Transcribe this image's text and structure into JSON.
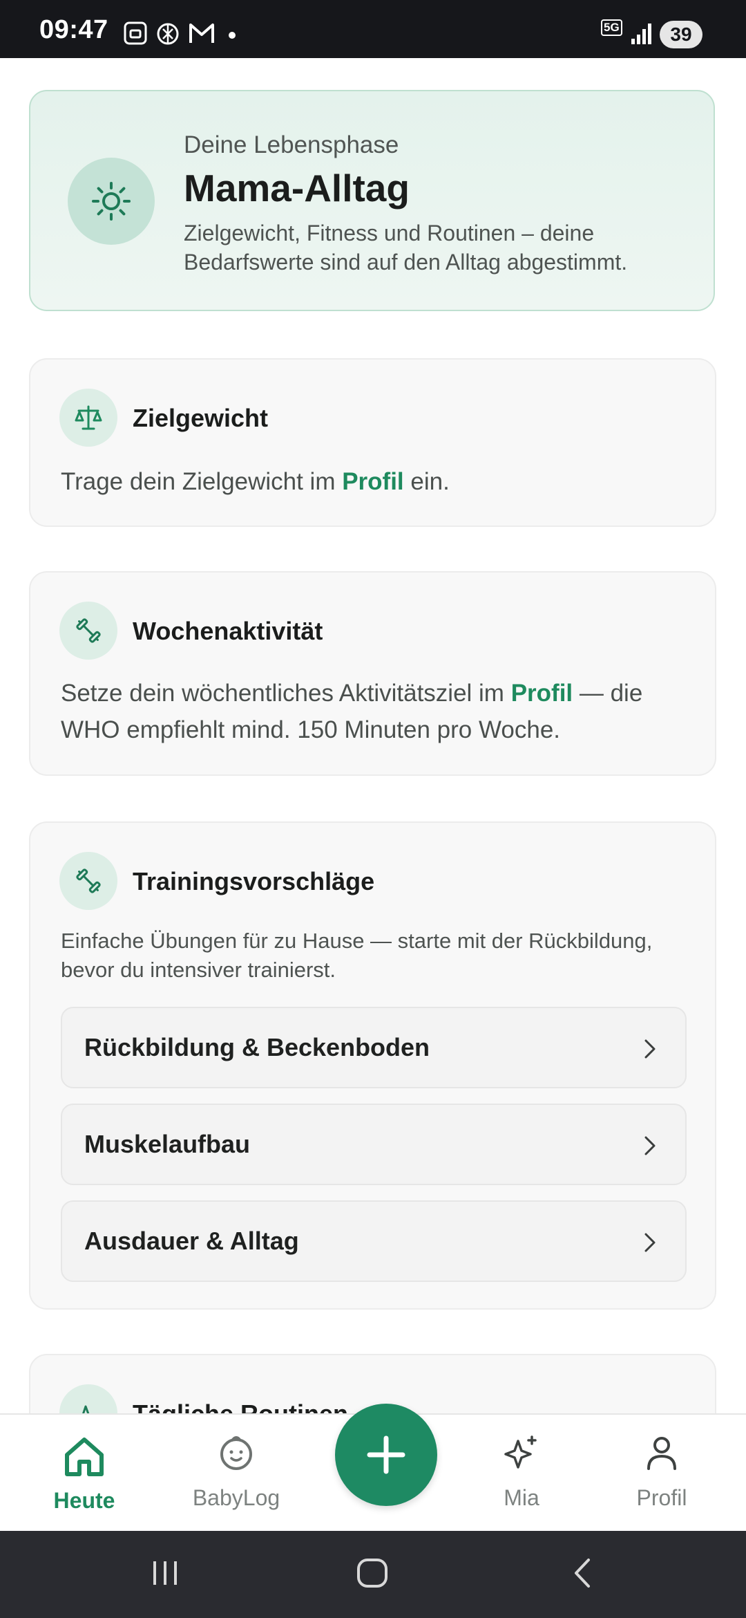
{
  "status_bar": {
    "time": "09:47",
    "network": "5G",
    "battery": "39"
  },
  "hero": {
    "subtitle": "Deine Lebensphase",
    "title": "Mama-Alltag",
    "description": "Zielgewicht, Fitness und Routinen – deine Bedarfswerte sind auf den Alltag abgestimmt.",
    "icon": "sun-icon"
  },
  "cards": {
    "target_weight": {
      "title": "Zielgewicht",
      "text_before": "Trage dein Zielgewicht im ",
      "link": "Profil",
      "text_after": " ein.",
      "icon": "scale-icon"
    },
    "weekly_activity": {
      "title": "Wochenaktivität",
      "text_before": "Setze dein wöchentliches Aktivitätsziel im ",
      "link": "Profil",
      "text_after": " — die WHO empfiehlt mind. 150 Minuten pro Woche.",
      "icon": "dumbbell-icon"
    },
    "training": {
      "title": "Trainingsvorschläge",
      "description": "Einfache Übungen für zu Hause — starte mit der Rückbildung, bevor du intensiver trainierst.",
      "icon": "dumbbell-icon",
      "items": [
        {
          "label": "Rückbildung & Beckenboden"
        },
        {
          "label": "Muskelaufbau"
        },
        {
          "label": "Ausdauer & Alltag"
        }
      ]
    },
    "routines": {
      "title": "Tägliche Routinen",
      "icon": "activity-icon"
    }
  },
  "bottom_nav": {
    "items": [
      {
        "label": "Heute",
        "icon": "home-icon",
        "active": true
      },
      {
        "label": "BabyLog",
        "icon": "baby-face-icon",
        "active": false
      },
      {
        "label": "Mia",
        "icon": "sparkle-icon",
        "active": false
      },
      {
        "label": "Profil",
        "icon": "person-icon",
        "active": false
      }
    ],
    "fab_icon": "plus-icon"
  },
  "colors": {
    "accent": "#1e8a63",
    "hero_bg": "#e4f2ec",
    "card_bg": "#f8f8f8",
    "status_bar_bg": "#16171b",
    "system_nav_bg": "#2a2b30"
  }
}
